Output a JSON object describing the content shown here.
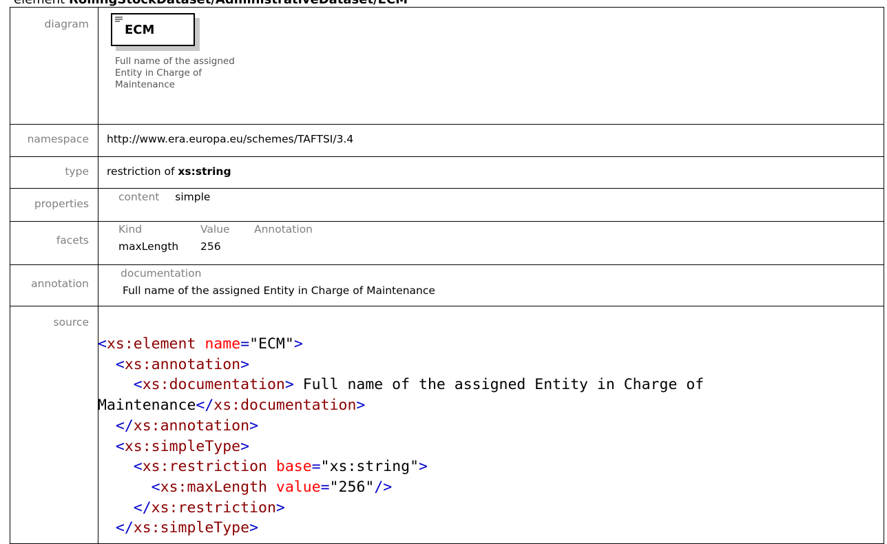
{
  "heading": {
    "prefix": "element",
    "path": "RollingStockDataset/AdministrativeDataset/ECM"
  },
  "diagram": {
    "label": "diagram",
    "element_name": "ECM",
    "doc_line1": "Full name of the assigned",
    "doc_line2": "Entity in Charge of",
    "doc_line3": "Maintenance",
    "icon": "element-box-icon"
  },
  "namespace": {
    "label": "namespace",
    "value": "http://www.era.europa.eu/schemes/TAFTSI/3.4"
  },
  "type": {
    "label": "type",
    "prefix": "restriction of",
    "base": "xs:string"
  },
  "properties": {
    "label": "properties",
    "key": "content",
    "value": "simple"
  },
  "facets": {
    "label": "facets",
    "col_kind": "Kind",
    "col_value": "Value",
    "col_annotation": "Annotation",
    "kind": "maxLength",
    "value": "256"
  },
  "annotation": {
    "label": "annotation",
    "sublabel": "documentation",
    "text": "Full name of the assigned Entity in Charge of Maintenance"
  },
  "source": {
    "label": "source",
    "line1_tag": "xs:element",
    "line1_attr": "name",
    "line1_val": "\"ECM\"",
    "line2_tag": "xs:annotation",
    "line3_tag": "xs:documentation",
    "line3_text": " Full name of the assigned Entity in Charge of",
    "line4_text": "Maintenance",
    "line4_close": "xs:documentation",
    "line5_close": "xs:annotation",
    "line6_tag": "xs:simpleType",
    "line7_tag": "xs:restriction",
    "line7_attr": "base",
    "line7_val": "\"xs:string\"",
    "line8_tag": "xs:maxLength",
    "line8_attr": "value",
    "line8_val": "\"256\"",
    "line9_close": "xs:restriction",
    "line10_close": "xs:simpleType"
  }
}
